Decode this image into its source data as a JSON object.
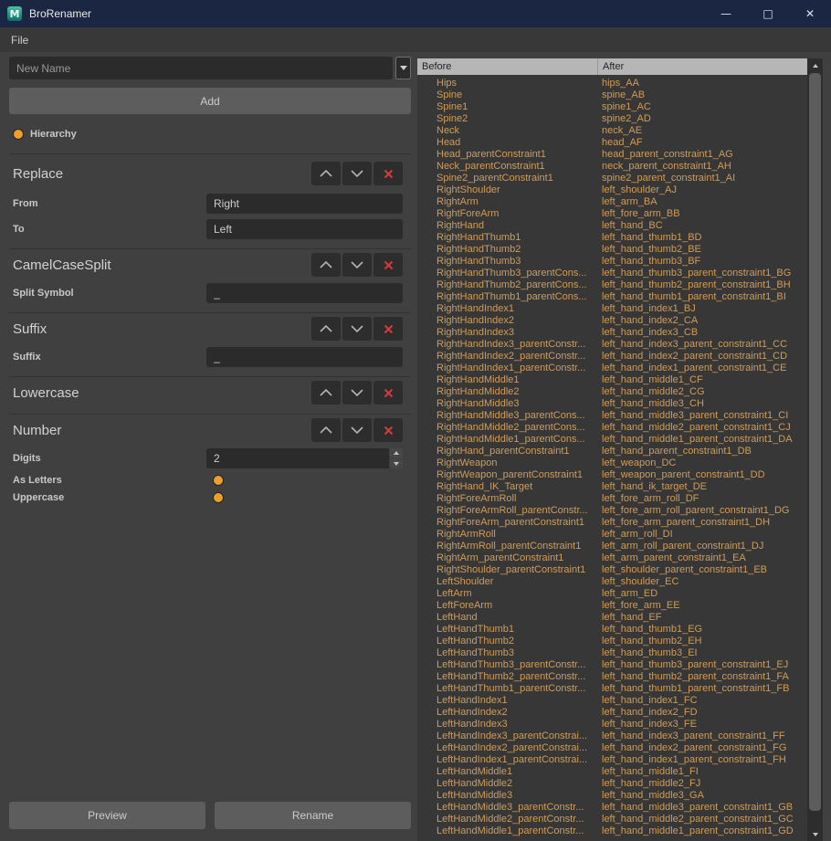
{
  "titlebar": {
    "title": "BroRenamer",
    "minimize": "—",
    "maximize": "□",
    "close": "✕"
  },
  "menubar": {
    "file": "File"
  },
  "left_panel": {
    "new_name": {
      "placeholder": "New Name",
      "value": ""
    },
    "add_button": "Add",
    "hierarchy": {
      "label": "Hierarchy",
      "checked": true
    },
    "sections": {
      "replace": {
        "title": "Replace",
        "from_label": "From",
        "from_value": "Right",
        "to_label": "To",
        "to_value": "Left"
      },
      "camelcase": {
        "title": "CamelCaseSplit",
        "split_label": "Split Symbol",
        "split_value": "_"
      },
      "suffix": {
        "title": "Suffix",
        "suffix_label": "Suffix",
        "suffix_value": "_"
      },
      "lowercase": {
        "title": "Lowercase"
      },
      "number": {
        "title": "Number",
        "digits_label": "Digits",
        "digits_value": "2",
        "as_letters_label": "As Letters",
        "as_letters_checked": true,
        "uppercase_label": "Uppercase",
        "uppercase_checked": true
      }
    },
    "preview_button": "Preview",
    "rename_button": "Rename"
  },
  "table": {
    "columns": [
      "Before",
      "After"
    ],
    "rows": [
      [
        "Hips",
        "hips_AA"
      ],
      [
        "Spine",
        "spine_AB"
      ],
      [
        "Spine1",
        "spine1_AC"
      ],
      [
        "Spine2",
        "spine2_AD"
      ],
      [
        "Neck",
        "neck_AE"
      ],
      [
        "Head",
        "head_AF"
      ],
      [
        "Head_parentConstraint1",
        "head_parent_constraint1_AG"
      ],
      [
        "Neck_parentConstraint1",
        "neck_parent_constraint1_AH"
      ],
      [
        "Spine2_parentConstraint1",
        "spine2_parent_constraint1_AI"
      ],
      [
        "RightShoulder",
        "left_shoulder_AJ"
      ],
      [
        "RightArm",
        "left_arm_BA"
      ],
      [
        "RightForeArm",
        "left_fore_arm_BB"
      ],
      [
        "RightHand",
        "left_hand_BC"
      ],
      [
        "RightHandThumb1",
        "left_hand_thumb1_BD"
      ],
      [
        "RightHandThumb2",
        "left_hand_thumb2_BE"
      ],
      [
        "RightHandThumb3",
        "left_hand_thumb3_BF"
      ],
      [
        "RightHandThumb3_parentCons...",
        "left_hand_thumb3_parent_constraint1_BG"
      ],
      [
        "RightHandThumb2_parentCons...",
        "left_hand_thumb2_parent_constraint1_BH"
      ],
      [
        "RightHandThumb1_parentCons...",
        "left_hand_thumb1_parent_constraint1_BI"
      ],
      [
        "RightHandIndex1",
        "left_hand_index1_BJ"
      ],
      [
        "RightHandIndex2",
        "left_hand_index2_CA"
      ],
      [
        "RightHandIndex3",
        "left_hand_index3_CB"
      ],
      [
        "RightHandIndex3_parentConstr...",
        "left_hand_index3_parent_constraint1_CC"
      ],
      [
        "RightHandIndex2_parentConstr...",
        "left_hand_index2_parent_constraint1_CD"
      ],
      [
        "RightHandIndex1_parentConstr...",
        "left_hand_index1_parent_constraint1_CE"
      ],
      [
        "RightHandMiddle1",
        "left_hand_middle1_CF"
      ],
      [
        "RightHandMiddle2",
        "left_hand_middle2_CG"
      ],
      [
        "RightHandMiddle3",
        "left_hand_middle3_CH"
      ],
      [
        "RightHandMiddle3_parentCons...",
        "left_hand_middle3_parent_constraint1_CI"
      ],
      [
        "RightHandMiddle2_parentCons...",
        "left_hand_middle2_parent_constraint1_CJ"
      ],
      [
        "RightHandMiddle1_parentCons...",
        "left_hand_middle1_parent_constraint1_DA"
      ],
      [
        "RightHand_parentConstraint1",
        "left_hand_parent_constraint1_DB"
      ],
      [
        "RightWeapon",
        "left_weapon_DC"
      ],
      [
        "RightWeapon_parentConstraint1",
        "left_weapon_parent_constraint1_DD"
      ],
      [
        "RightHand_IK_Target",
        "left_hand_ik_target_DE"
      ],
      [
        "RightForeArmRoll",
        "left_fore_arm_roll_DF"
      ],
      [
        "RightForeArmRoll_parentConstr...",
        "left_fore_arm_roll_parent_constraint1_DG"
      ],
      [
        "RightForeArm_parentConstraint1",
        "left_fore_arm_parent_constraint1_DH"
      ],
      [
        "RightArmRoll",
        "left_arm_roll_DI"
      ],
      [
        "RightArmRoll_parentConstraint1",
        "left_arm_roll_parent_constraint1_DJ"
      ],
      [
        "RightArm_parentConstraint1",
        "left_arm_parent_constraint1_EA"
      ],
      [
        "RightShoulder_parentConstraint1",
        "left_shoulder_parent_constraint1_EB"
      ],
      [
        "LeftShoulder",
        "left_shoulder_EC"
      ],
      [
        "LeftArm",
        "left_arm_ED"
      ],
      [
        "LeftForeArm",
        "left_fore_arm_EE"
      ],
      [
        "LeftHand",
        "left_hand_EF"
      ],
      [
        "LeftHandThumb1",
        "left_hand_thumb1_EG"
      ],
      [
        "LeftHandThumb2",
        "left_hand_thumb2_EH"
      ],
      [
        "LeftHandThumb3",
        "left_hand_thumb3_EI"
      ],
      [
        "LeftHandThumb3_parentConstr...",
        "left_hand_thumb3_parent_constraint1_EJ"
      ],
      [
        "LeftHandThumb2_parentConstr...",
        "left_hand_thumb2_parent_constraint1_FA"
      ],
      [
        "LeftHandThumb1_parentConstr...",
        "left_hand_thumb1_parent_constraint1_FB"
      ],
      [
        "LeftHandIndex1",
        "left_hand_index1_FC"
      ],
      [
        "LeftHandIndex2",
        "left_hand_index2_FD"
      ],
      [
        "LeftHandIndex3",
        "left_hand_index3_FE"
      ],
      [
        "LeftHandIndex3_parentConstrai...",
        "left_hand_index3_parent_constraint1_FF"
      ],
      [
        "LeftHandIndex2_parentConstrai...",
        "left_hand_index2_parent_constraint1_FG"
      ],
      [
        "LeftHandIndex1_parentConstrai...",
        "left_hand_index1_parent_constraint1_FH"
      ],
      [
        "LeftHandMiddle1",
        "left_hand_middle1_FI"
      ],
      [
        "LeftHandMiddle2",
        "left_hand_middle2_FJ"
      ],
      [
        "LeftHandMiddle3",
        "left_hand_middle3_GA"
      ],
      [
        "LeftHandMiddle3_parentConstr...",
        "left_hand_middle3_parent_constraint1_GB"
      ],
      [
        "LeftHandMiddle2_parentConstr...",
        "left_hand_middle2_parent_constraint1_GC"
      ],
      [
        "LeftHandMiddle1_parentConstr...",
        "left_hand_middle1_parent_constraint1_GD"
      ]
    ]
  },
  "colors": {
    "titlebar": "#1b2742",
    "accent": "#ef9f29",
    "red": "#d23b3b",
    "rowtext": "#d09c58",
    "header-bg": "#b6b6b6"
  }
}
